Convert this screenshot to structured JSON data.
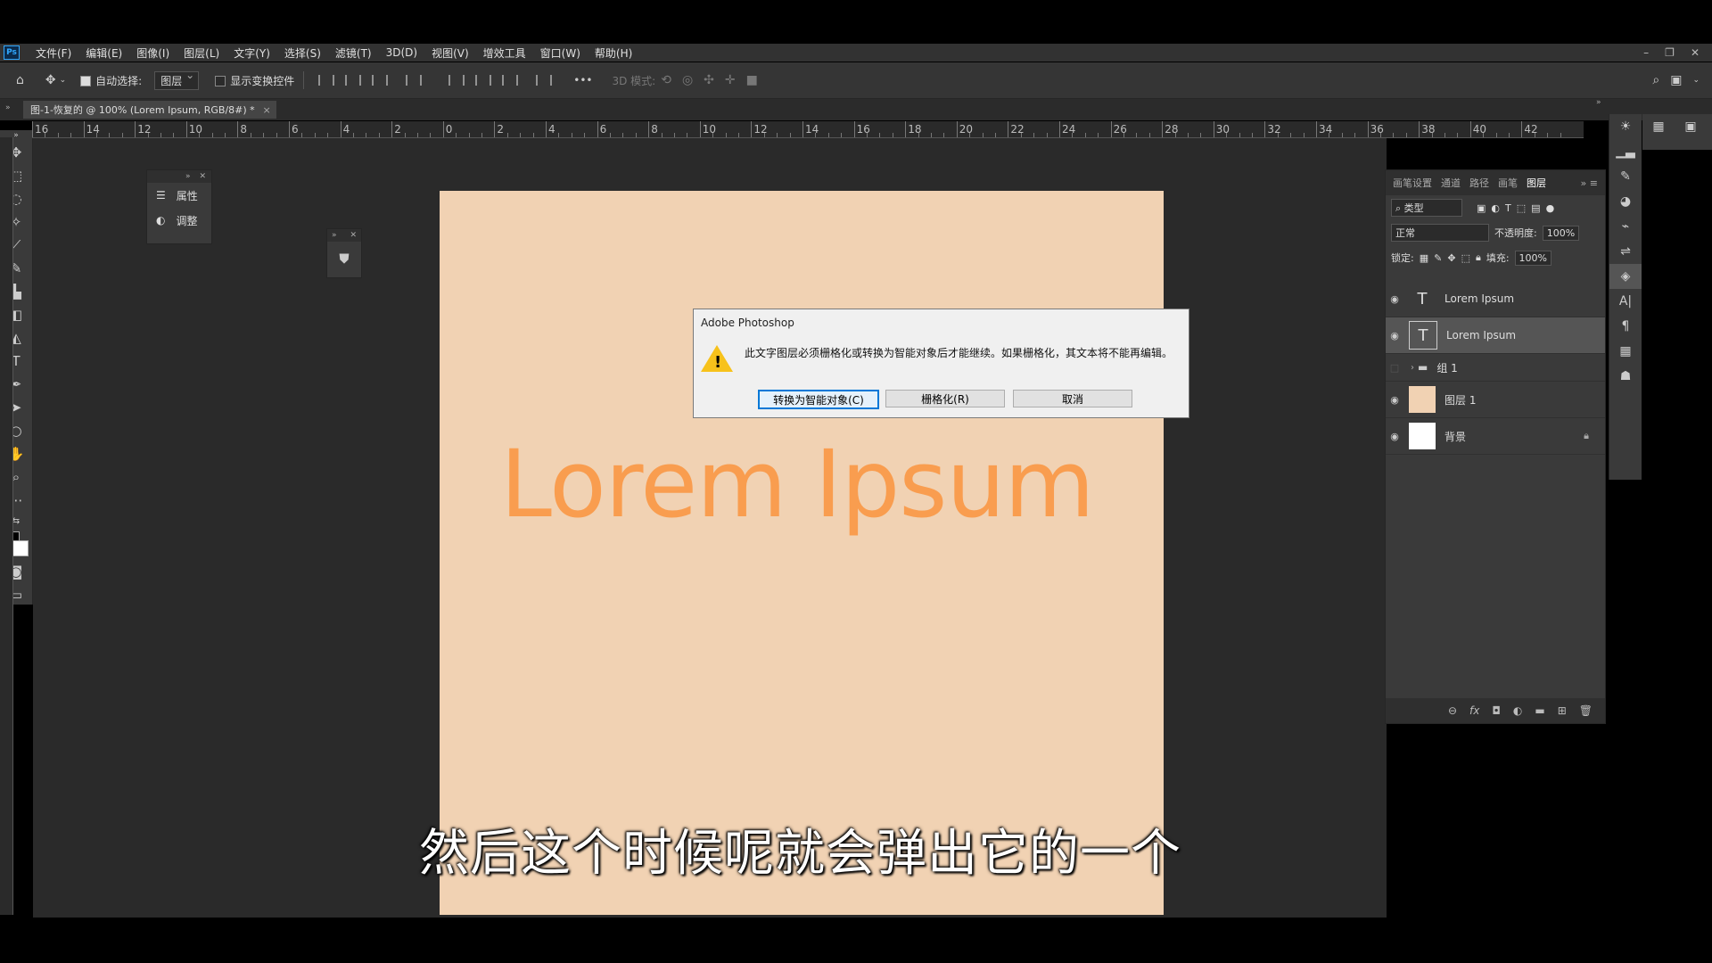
{
  "menubar": {
    "app_icon": "Ps",
    "items": [
      "文件(F)",
      "编辑(E)",
      "图像(I)",
      "图层(L)",
      "文字(Y)",
      "选择(S)",
      "滤镜(T)",
      "3D(D)",
      "视图(V)",
      "增效工具",
      "窗口(W)",
      "帮助(H)"
    ],
    "window_controls": [
      "–",
      "❐",
      "✕"
    ]
  },
  "options": {
    "auto_select_label": "自动选择:",
    "auto_select_value": "图层",
    "show_transform_label": "显示变换控件",
    "more": "•••",
    "mode_3d": "3D 模式:"
  },
  "tab": {
    "title": "图-1-恢复的 @ 100% (Lorem Ipsum, RGB/8#) *",
    "close": "×"
  },
  "ruler": {
    "labels": [
      "16",
      "14",
      "12",
      "10",
      "8",
      "6",
      "4",
      "2",
      "0",
      "2",
      "4",
      "6",
      "8",
      "10",
      "12",
      "14",
      "16",
      "18",
      "20",
      "22",
      "24",
      "26",
      "28",
      "30",
      "32",
      "34",
      "36",
      "38",
      "40",
      "42"
    ]
  },
  "float_panel_1": {
    "items": [
      {
        "icon": "properties-icon",
        "label": "属性"
      },
      {
        "icon": "adjustments-icon",
        "label": "调整"
      }
    ]
  },
  "canvas": {
    "text": "Lorem Ipsum",
    "bg_color": "#f1d2b3",
    "text_color": "#f99d4f"
  },
  "dialog": {
    "title": "Adobe Photoshop",
    "message": "此文字图层必须栅格化或转换为智能对象后才能继续。如果栅格化，其文本将不能再编辑。",
    "buttons": {
      "convert": "转换为智能对象(C)",
      "rasterize": "栅格化(R)",
      "cancel": "取消"
    }
  },
  "layers_panel": {
    "tabs": [
      "画笔设置",
      "通道",
      "路径",
      "画笔",
      "图层"
    ],
    "active_tab": "图层",
    "filter_label": "类型",
    "blend_mode": "正常",
    "opacity_label": "不透明度:",
    "opacity_value": "100%",
    "lock_label": "锁定:",
    "fill_label": "填充:",
    "fill_value": "100%",
    "layers": [
      {
        "name": "Lorem Ipsum",
        "type": "text",
        "visible": true,
        "selected": false
      },
      {
        "name": "Lorem Ipsum",
        "type": "text",
        "visible": true,
        "selected": true
      },
      {
        "name": "组 1",
        "type": "group",
        "visible": false,
        "selected": false
      },
      {
        "name": "图层 1",
        "type": "fill",
        "visible": true,
        "selected": false,
        "thumb_color": "#f1d2b3"
      },
      {
        "name": "背景",
        "type": "background",
        "visible": true,
        "selected": false,
        "thumb_color": "#ffffff",
        "locked": true
      }
    ],
    "footer_icons": [
      "link-icon",
      "fx-icon",
      "mask-icon",
      "adjustment-layer-icon",
      "folder-icon",
      "new-layer-icon",
      "trash-icon"
    ],
    "footer_fx": "fx"
  },
  "subtitle": "然后这个时候呢就会弹出它的一个"
}
